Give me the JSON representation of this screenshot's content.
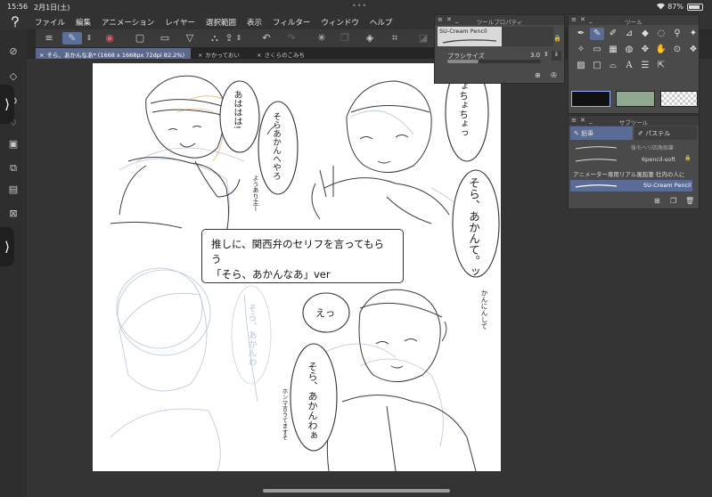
{
  "status": {
    "time": "15:56",
    "date": "2月1日(土)",
    "dots": "•••",
    "battery_text": "87%",
    "battery_level": 0.87
  },
  "menu": {
    "items": [
      "ファイル",
      "編集",
      "アニメーション",
      "レイヤー",
      "選択範囲",
      "表示",
      "フィルター",
      "ウィンドウ",
      "ヘルプ"
    ]
  },
  "tabs": [
    {
      "label": "そら、あかんなあ* (1668 x 1668px 72dpi 82.2%)",
      "close": "×"
    },
    {
      "label": "かかっておい",
      "close": "×"
    },
    {
      "label": "さくらのこみち",
      "close": "×"
    }
  ],
  "tool_property": {
    "title": "ツールプロパティ",
    "brush_name": "SU-Cream Pencil",
    "size_label": "ブラシサイズ",
    "size_value": "3.0",
    "size_level": 0.33
  },
  "tools": {
    "title": "ツール"
  },
  "subtool": {
    "title": "サブツール",
    "tab_pencil": "鉛筆",
    "tab_pastel": "パステル",
    "items": [
      {
        "name": "後モヘリ四角鉛筆",
        "selected": false
      },
      {
        "name": "6pencil-soft",
        "selected": false
      },
      {
        "name": "アニメーター専用リアル風鉛筆 社内の人に",
        "selected": false
      },
      {
        "name": "SU-Cream Pencil",
        "selected": true
      }
    ]
  },
  "colors": {
    "main": "#111111",
    "sub": "#8fa88f",
    "accent": "#5a6c96"
  },
  "canvas": {
    "caption_line1": "推しに、関西弁のセリフを言ってもらう",
    "caption_line2": "「そら、あかんなあ」ver",
    "bubbles": {
      "ahaha": "あははは!",
      "sora_top": "そらあかんへやろ",
      "side_note": "ようあり主ー",
      "chotto": "ちょちょちょっ",
      "sora_big": "そら、あかんて。ッ",
      "kanini": "かんにんして",
      "e": "えっ",
      "sora_bottom": "そら、あかんわぁ",
      "small_note": "ホンマ言うてますそ",
      "faded": "そら、あかんわ"
    }
  }
}
